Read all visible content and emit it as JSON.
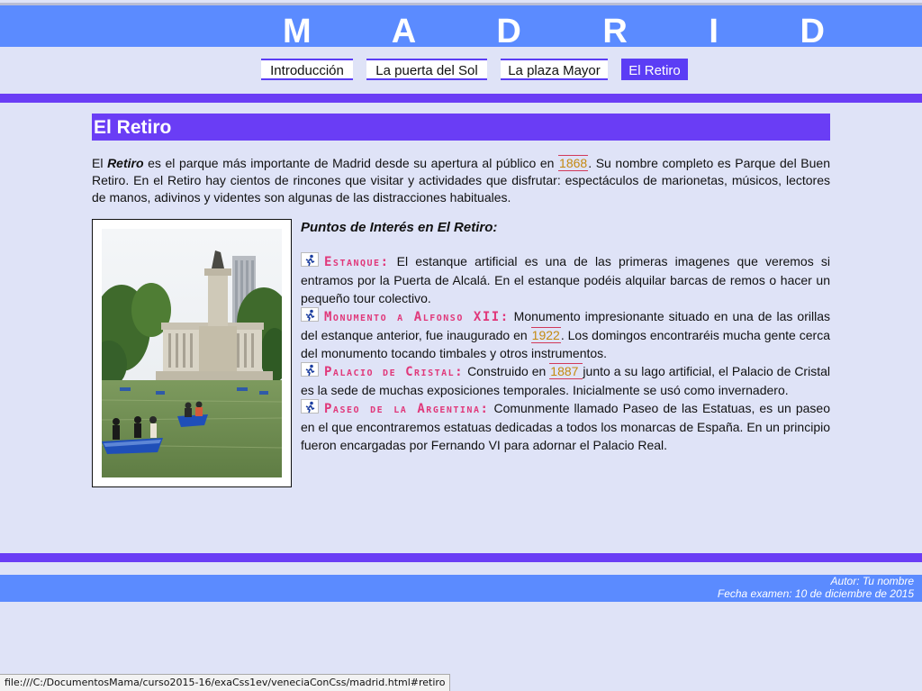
{
  "header": {
    "title": "M A D R I D"
  },
  "nav": {
    "items": [
      {
        "label": "Introducción",
        "active": false
      },
      {
        "label": "La puerta del Sol",
        "active": false
      },
      {
        "label": "La plaza Mayor",
        "active": false
      },
      {
        "label": "El Retiro",
        "active": true
      }
    ]
  },
  "section": {
    "title": "El Retiro",
    "intro": {
      "p1": "El ",
      "bold": "Retiro",
      "p2": " es el parque más importante de Madrid desde su apertura al público en ",
      "year": "1868",
      "p3": ". Su nombre completo es Parque del Buen Retiro. En el Retiro hay cientos de rincones que visitar y actividades que disfrutar: espectáculos de marionetas, músicos, lectores de manos, adivinos y videntes son algunas de las distracciones habituales."
    },
    "points_title": "Puntos de Interés en El Retiro:",
    "points": [
      {
        "name": "Estanque:",
        "text_before": " El estanque artificial es una de las primeras imagenes que veremos si entramos por la Puerta de Alcalá. En el estanque podéis alquilar barcas de remos o hacer un pequeño tour colectivo.",
        "year": "",
        "text_after": ""
      },
      {
        "name": "Monumento a Alfonso XII:",
        "text_before": " Monumento impresionante situado en una de las orillas del estanque anterior, fue inaugurado en ",
        "year": "1922",
        "text_after": ". Los domingos encontraréis mucha gente cerca del monumento tocando timbales y otros instrumentos."
      },
      {
        "name": "Palacio de Cristal:",
        "text_before": " Construido en ",
        "year": "1887 ",
        "text_after": "junto a su lago artificial, el Palacio de Cristal es la sede de muchas exposiciones temporales. Inicialmente se usó como invernadero."
      },
      {
        "name": "Paseo de la Argentina:",
        "text_before": " Comunmente llamado Paseo de las Estatuas, es un paseo en el que encontraremos estatuas dedicadas a todos los monarcas de España. En un principio fueron encargadas por Fernando VI para adornar el Palacio Real.",
        "year": "",
        "text_after": ""
      }
    ]
  },
  "footer": {
    "author": "Autor: Tu nombre",
    "date": "Fecha examen: 10 de diciembre de 2015"
  },
  "status_bar": {
    "url": "file:///C:/DocumentosMama/curso2015-16/exaCss1ev/veneciaConCss/madrid.html#retiro"
  },
  "colors": {
    "header_blue": "#5b8bff",
    "accent_purple": "#6a3df5",
    "page_bg": "#dfe3f7",
    "point_name": "#e0387a",
    "year": "#c48a10"
  }
}
